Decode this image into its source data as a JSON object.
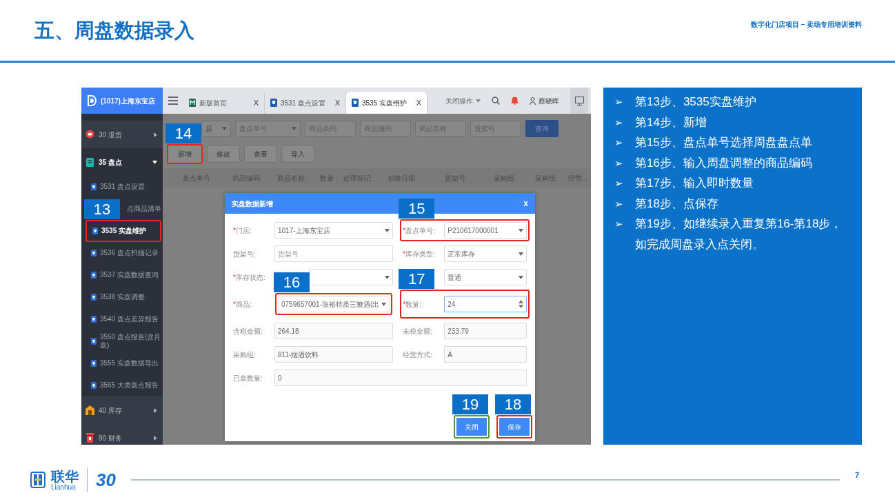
{
  "slide": {
    "title": "五、周盘数据录入",
    "subtitle": "数字化门店项目 – 卖场专用培训资料",
    "page_number": "7"
  },
  "app": {
    "store_name": "(1017)上海东宝店",
    "sidebar": [
      {
        "label": "30 退货",
        "kind": "return",
        "expanded": false
      },
      {
        "label": "35 盘点",
        "kind": "count",
        "expanded": true,
        "children": [
          {
            "label": "3531 盘点设置",
            "selected": false
          },
          {
            "label": "点商品清单",
            "selected": false,
            "covered": true
          },
          {
            "label": "3535 实盘维护",
            "selected": true,
            "highlight": {
              "color": "#e8241c"
            },
            "callout": "13"
          },
          {
            "label": "3536 盘点扫描记录",
            "selected": false
          },
          {
            "label": "3537 实盘数据查询",
            "selected": false
          },
          {
            "label": "3538 实盘调整",
            "selected": false
          },
          {
            "label": "3540 盘点差异报告",
            "selected": false
          },
          {
            "label": "3550 盘点报告(含月盘)",
            "selected": false
          },
          {
            "label": "3555 实盘数据导出",
            "selected": false
          },
          {
            "label": "3565 大类盘点报告",
            "selected": false
          }
        ]
      },
      {
        "label": "40 库存",
        "kind": "stock",
        "expanded": false
      },
      {
        "label": "90 财务",
        "kind": "finance",
        "expanded": false
      }
    ],
    "tabs": [
      {
        "label": "新版首页",
        "kind": "home",
        "close": "X",
        "selected": false
      },
      {
        "label": "3531 盘点设置",
        "kind": "page",
        "close": "X",
        "selected": false
      },
      {
        "label": "3535 实盘维护",
        "kind": "page",
        "close": "X",
        "selected": true
      }
    ],
    "topbar": {
      "close_menu": "关闭操作",
      "user": "蔡晓晖"
    },
    "filters": [
      {
        "kind": "select",
        "value": "店",
        "covered": true
      },
      {
        "kind": "select",
        "placeholder": "盘点单号"
      },
      {
        "kind": "input",
        "placeholder": "商品条码"
      },
      {
        "kind": "input",
        "placeholder": "商品编码"
      },
      {
        "kind": "input",
        "placeholder": "商品名称"
      },
      {
        "kind": "input",
        "placeholder": "货架号"
      }
    ],
    "search_button": "查询",
    "actions": [
      {
        "label": "新增",
        "highlight": {
          "color": "#e8241c"
        },
        "callout": "14"
      },
      {
        "label": "修改"
      },
      {
        "label": "查看"
      },
      {
        "label": "导入"
      }
    ],
    "columns": [
      "盘点单号",
      "商品编码",
      "商品名称",
      "数量",
      "处理标记",
      "创建日期",
      "货架号",
      "采购组",
      "采购组",
      "经营..."
    ],
    "dialog": {
      "title": "实盘数据新增",
      "close": "x",
      "fields": [
        {
          "required_mark": "*",
          "label": "门店:",
          "kind": "select",
          "value": "1017-上海东宝店"
        },
        {
          "required_mark": "*",
          "label": "盘点单号:",
          "kind": "select",
          "value": "P210617000001",
          "highlight": {
            "color": "#e8241c",
            "kind": "row"
          },
          "callout": "15"
        },
        {
          "label": "货架号:",
          "kind": "input",
          "placeholder": "货架号"
        },
        {
          "required_mark": "*",
          "label": "库存类型:",
          "kind": "select",
          "value": "正常库存"
        },
        {
          "required_mark": "*",
          "label": "库存状态:",
          "kind": "select",
          "covered": true
        },
        {
          "kind": "select",
          "value": "普通"
        },
        {
          "required_mark": "*",
          "label": "商品:",
          "kind": "select",
          "value": "0759657001-张裕特质三鞭酒(出",
          "highlight": {
            "color": "#e8241c",
            "kind": "control"
          },
          "callout": "16"
        },
        {
          "required_mark": "*",
          "label": "数量:",
          "kind": "number",
          "value": "24",
          "focused": true,
          "highlight": {
            "color": "#e8241c",
            "kind": "row"
          },
          "callout": "17"
        },
        {
          "label": "含税金额:",
          "kind": "readonly",
          "value": "264.18"
        },
        {
          "label": "未税金额:",
          "kind": "readonly",
          "value": "233.79"
        },
        {
          "label": "采购组:",
          "kind": "readonly",
          "value": "811-烟酒饮料"
        },
        {
          "label": "经营方式:",
          "kind": "readonly",
          "value": "A"
        },
        {
          "label": "已盘数量:",
          "kind": "readonly",
          "value": "0",
          "wide": true
        }
      ],
      "buttons": [
        {
          "label": "关闭",
          "highlight": {
            "color": "#4f9a2d"
          },
          "callout": "19"
        },
        {
          "label": "保存",
          "highlight": {
            "color": "#e8241c"
          },
          "callout": "18"
        }
      ]
    }
  },
  "steps": [
    {
      "bullet": "➢",
      "text": "第13步、3535实盘维护"
    },
    {
      "bullet": "➢",
      "text": "第14步、新增"
    },
    {
      "bullet": "➢",
      "text": "第15步、盘点单号选择周盘盘点单"
    },
    {
      "bullet": "➢",
      "text": "第16步、输入周盘调整的商品编码"
    },
    {
      "bullet": "➢",
      "text": "第17步、输入即时数量"
    },
    {
      "bullet": "➢",
      "text": "第18步、点保存"
    },
    {
      "bullet": "➢",
      "text": "第19步、如继续录入重复第16-第18步，如完成周盘录入点关闭。"
    }
  ],
  "footer": {
    "brand_cn": "联华",
    "brand_en": "Lianhua",
    "anniversary": "30"
  }
}
